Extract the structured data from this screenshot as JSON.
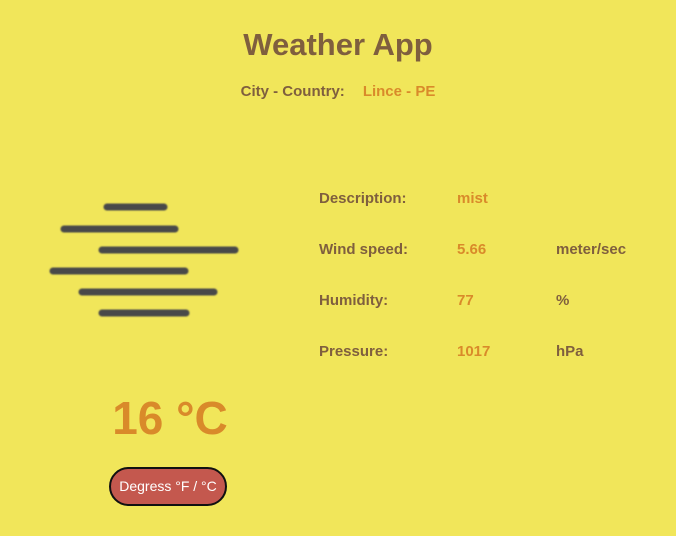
{
  "app": {
    "title": "Weather App"
  },
  "location": {
    "label": "City - Country:",
    "value": "Lince - PE"
  },
  "weather": {
    "icon": "mist-icon",
    "temperature": "16 °C"
  },
  "toggle": {
    "label": "Degress °F / °C"
  },
  "details": [
    {
      "label": "Description:",
      "value": "mist",
      "unit": ""
    },
    {
      "label": "Wind speed:",
      "value": "5.66",
      "unit": "meter/sec"
    },
    {
      "label": "Humidity:",
      "value": "77",
      "unit": "%"
    },
    {
      "label": "Pressure:",
      "value": "1017",
      "unit": "hPa"
    }
  ],
  "colors": {
    "background": "#f1e65a",
    "heading": "#7f5f3e",
    "accent": "#d98a2a",
    "button": "#c4584e",
    "icon": "#4a4a4a"
  }
}
